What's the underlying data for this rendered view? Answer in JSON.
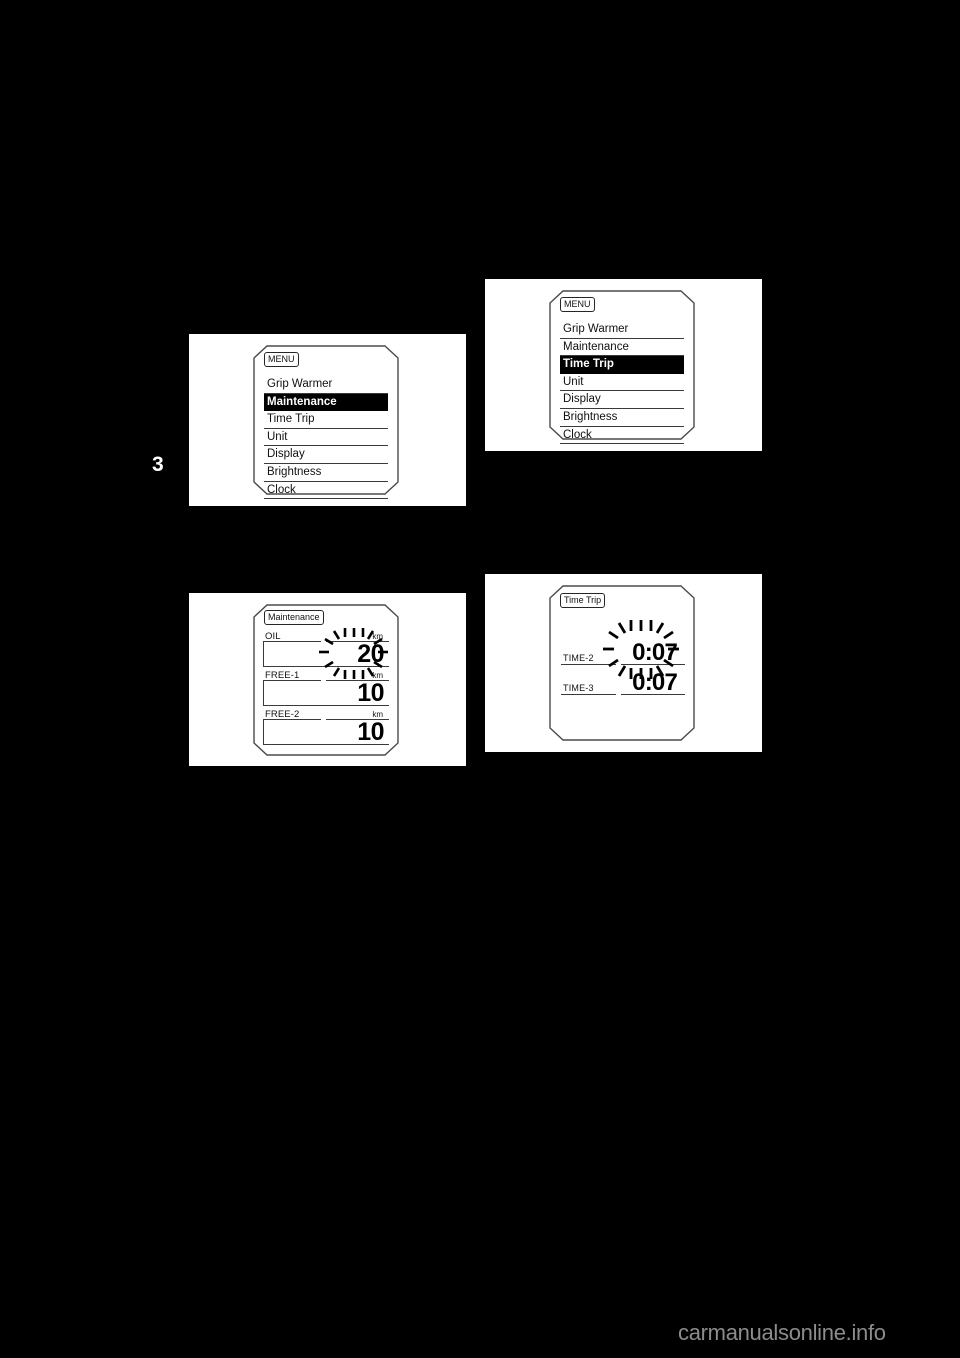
{
  "page": {
    "background_color": "#000000",
    "chapter_number": "3",
    "watermark": "carmanualsonline.info",
    "watermark_color": "#8c8c8c"
  },
  "figures": {
    "menu_maintenance": {
      "screen_title": "MENU",
      "items": [
        {
          "label": "Grip Warmer",
          "selected": false
        },
        {
          "label": "Maintenance",
          "selected": true
        },
        {
          "label": "Time Trip",
          "selected": false
        },
        {
          "label": "Unit",
          "selected": false
        },
        {
          "label": "Display",
          "selected": false
        },
        {
          "label": "Brightness",
          "selected": false
        },
        {
          "label": "Clock",
          "selected": false
        }
      ],
      "highlight_color": "#000000",
      "highlight_text_color": "#ffffff"
    },
    "menu_timetrip": {
      "screen_title": "MENU",
      "items": [
        {
          "label": "Grip Warmer",
          "selected": false
        },
        {
          "label": "Maintenance",
          "selected": false
        },
        {
          "label": "Time Trip",
          "selected": true
        },
        {
          "label": "Unit",
          "selected": false
        },
        {
          "label": "Display",
          "selected": false
        },
        {
          "label": "Brightness",
          "selected": false
        },
        {
          "label": "Clock",
          "selected": false
        }
      ],
      "highlight_color": "#000000",
      "highlight_text_color": "#ffffff"
    },
    "maintenance": {
      "screen_title": "Maintenance",
      "rows": [
        {
          "label": "OIL",
          "unit": "km",
          "value": "20",
          "blinking": true
        },
        {
          "label": "FREE-1",
          "unit": "km",
          "value": "10",
          "blinking": false
        },
        {
          "label": "FREE-2",
          "unit": "km",
          "value": "10",
          "blinking": false
        }
      ]
    },
    "time_trip": {
      "screen_title": "Time Trip",
      "rows": [
        {
          "label": "TIME-2",
          "value": "0:07",
          "blinking": true
        },
        {
          "label": "TIME-3",
          "value": "0:07",
          "blinking": false
        }
      ]
    }
  }
}
